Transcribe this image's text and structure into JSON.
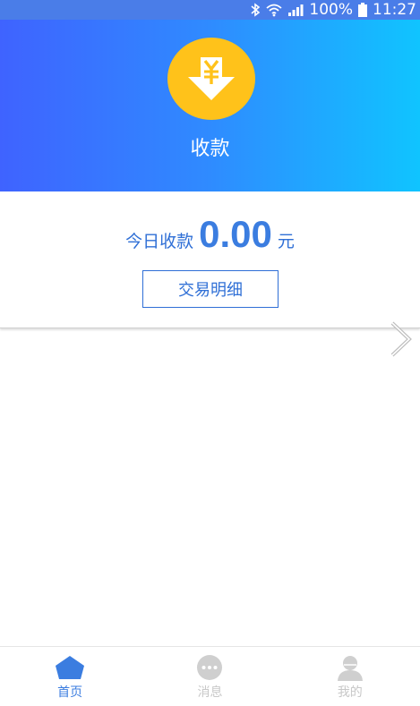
{
  "status_bar": {
    "battery": "100%",
    "time": "11:27"
  },
  "header": {
    "title": "收款",
    "icon": "yen-download-icon"
  },
  "summary": {
    "today_label": "今日收款",
    "today_amount": "0.00",
    "unit": "元",
    "detail_button": "交易明细"
  },
  "bottom_nav": {
    "items": [
      {
        "label": "首页",
        "icon": "home-icon",
        "active": true
      },
      {
        "label": "消息",
        "icon": "message-icon",
        "active": false
      },
      {
        "label": "我的",
        "icon": "profile-icon",
        "active": false
      }
    ]
  },
  "colors": {
    "accent": "#3b7de0",
    "coin": "#ffc21a",
    "gradient_start": "#3f63ff",
    "gradient_end": "#10c4ff"
  }
}
